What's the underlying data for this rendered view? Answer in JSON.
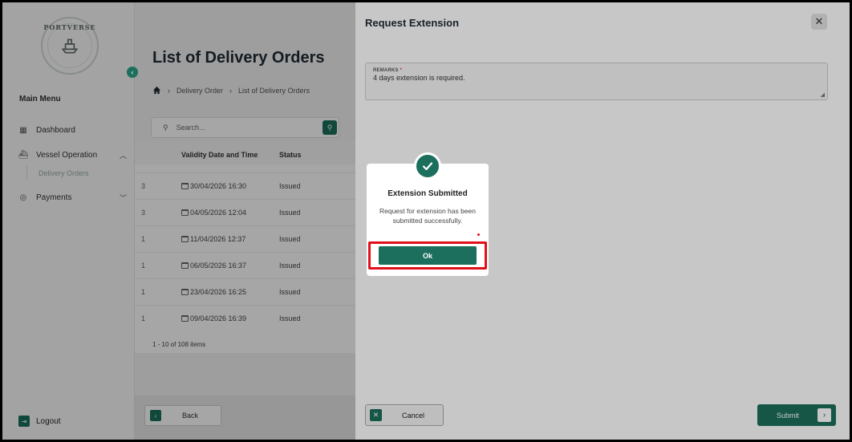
{
  "sidebar": {
    "logo_text": "PORTVERSE",
    "menu_title": "Main Menu",
    "items": [
      {
        "label": "Dashboard"
      },
      {
        "label": "Vessel Operation"
      },
      {
        "label": "Payments"
      }
    ],
    "sub_item": "Delivery Orders",
    "logout_label": "Logout"
  },
  "main": {
    "title": "List of Delivery Orders",
    "breadcrumbs": [
      "Delivery Order",
      "List of Delivery Orders"
    ],
    "search_placeholder": "Search...",
    "table": {
      "headers": [
        "Validity Date and Time",
        "Status"
      ],
      "rows": [
        {
          "c0": "3",
          "date": "30/04/2026 16:30",
          "status": "Issued"
        },
        {
          "c0": "3",
          "date": "04/05/2026 12:04",
          "status": "Issued"
        },
        {
          "c0": "1",
          "date": "11/04/2026 12:37",
          "status": "Issued"
        },
        {
          "c0": "1",
          "date": "06/05/2026 16:37",
          "status": "Issued"
        },
        {
          "c0": "1",
          "date": "23/04/2026 16:25",
          "status": "Issued"
        },
        {
          "c0": "1",
          "date": "09/04/2026 16:39",
          "status": "Issued"
        }
      ]
    },
    "count_text": "1 - 10 of 108 items",
    "back_label": "Back"
  },
  "panel": {
    "title": "Request Extension",
    "remarks_label": "REMARKS",
    "remarks_required": "*",
    "remarks_value": "4 days extension is required.",
    "cancel_label": "Cancel",
    "submit_label": "Submit"
  },
  "dialog": {
    "title": "Extension Submitted",
    "message": "Request for extension has been submitted successfully.",
    "ok_label": "Ok"
  },
  "colors": {
    "accent": "#1b6f5c",
    "highlight": "#e0101a"
  }
}
